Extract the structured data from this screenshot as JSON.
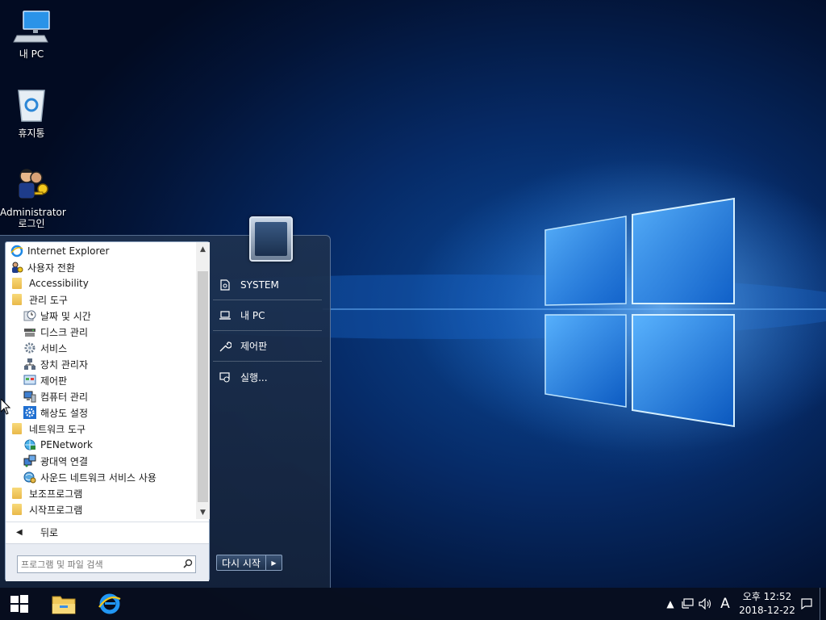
{
  "desktop": {
    "icons": [
      {
        "label": "내 PC",
        "icon": "computer-icon"
      },
      {
        "label": "휴지통",
        "icon": "recycle-bin-icon"
      },
      {
        "label": "Administrator\n로그인",
        "line1": "Administrator",
        "line2": "로그인",
        "icon": "administrator-users-icon"
      }
    ]
  },
  "start_menu": {
    "programs": [
      {
        "label": "Internet Explorer",
        "icon": "internet-explorer-icon",
        "level": 0
      },
      {
        "label": "사용자 전환",
        "icon": "switch-user-icon",
        "level": 0
      },
      {
        "label": "Accessibility",
        "icon": "folder-icon",
        "level": 0
      },
      {
        "label": "관리 도구",
        "icon": "folder-icon",
        "level": 0
      },
      {
        "label": "날짜 및 시간",
        "icon": "clock-icon",
        "level": 1
      },
      {
        "label": "디스크 관리",
        "icon": "disk-icon",
        "level": 1
      },
      {
        "label": "서비스",
        "icon": "gear-icon",
        "level": 1
      },
      {
        "label": "장치 관리자",
        "icon": "device-manager-icon",
        "level": 1
      },
      {
        "label": "제어판",
        "icon": "control-panel-icon",
        "level": 1
      },
      {
        "label": "컴퓨터 관리",
        "icon": "computer-management-icon",
        "level": 1
      },
      {
        "label": "해상도 설정",
        "icon": "settings-gear-icon",
        "level": 1
      },
      {
        "label": "네트워크 도구",
        "icon": "folder-icon",
        "level": 0
      },
      {
        "label": "PENetwork",
        "icon": "network-globe-icon",
        "level": 1
      },
      {
        "label": "광대역 연결",
        "icon": "broadband-icon",
        "level": 1
      },
      {
        "label": "사운드 네트워크 서비스 사용",
        "icon": "network-service-icon",
        "level": 1
      },
      {
        "label": "보조프로그램",
        "icon": "folder-icon",
        "level": 0
      },
      {
        "label": "시작프로그램",
        "icon": "folder-icon",
        "level": 0
      }
    ],
    "back_label": "뒤로",
    "search_placeholder": "프로그램 및 파일 검색",
    "right_items": [
      {
        "label": "SYSTEM",
        "icon": "user-folder-icon"
      },
      {
        "label": "내 PC",
        "icon": "laptop-icon"
      },
      {
        "label": "제어판",
        "icon": "wrench-icon"
      },
      {
        "label": "실행...",
        "icon": "run-icon"
      }
    ],
    "restart_label": "다시 시작"
  },
  "taskbar": {
    "apps": [
      {
        "name": "file-explorer",
        "icon": "folder-icon"
      },
      {
        "name": "internet-explorer",
        "icon": "internet-explorer-icon"
      }
    ],
    "tray": {
      "input_indicator": "A",
      "time": "오후 12:52",
      "date": "2018-12-22"
    }
  },
  "colors": {
    "accent": "#1e90ff",
    "taskbar": "#080e1e",
    "folder": "#f0c85a"
  }
}
